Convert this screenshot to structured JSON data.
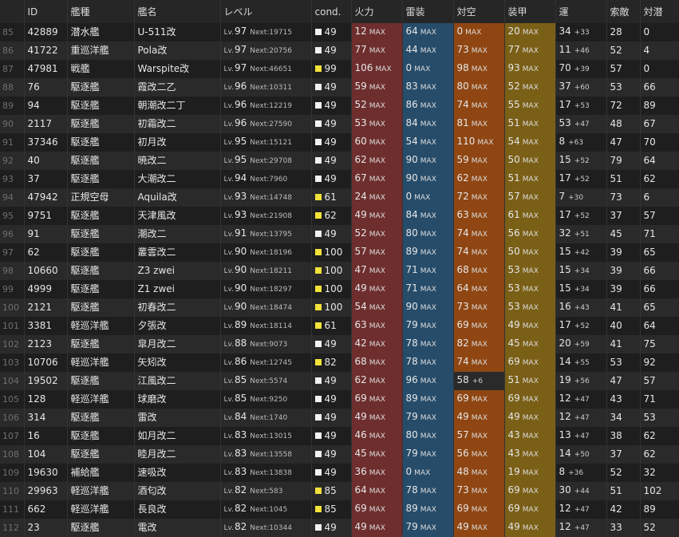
{
  "colors": {
    "cond_white": "#f2f2f2",
    "cond_yellow": "#f2e23a"
  },
  "header": {
    "no": "",
    "id": "ID",
    "type": "艦種",
    "name": "艦名",
    "level": "レベル",
    "cond": "cond.",
    "firepower": "火力",
    "torpedo": "雷装",
    "antiair": "対空",
    "armor": "装甲",
    "luck": "運",
    "los": "索敵",
    "asw": "対潜"
  },
  "labels": {
    "lv": "Lv.",
    "next": "Next:",
    "max": "MAX"
  },
  "rows": [
    {
      "no": "85",
      "id": "42889",
      "type": "潜水艦",
      "name": "U-511改",
      "lv": "97",
      "next": "19715",
      "cond": "49",
      "cond_color": "white",
      "fp": "12",
      "fp_max": true,
      "tp": "64",
      "tp_max": true,
      "aa": "0",
      "aa_max": true,
      "ar": "20",
      "ar_max": true,
      "luck": "34",
      "luck_inc": "+33",
      "los": "28",
      "asw": "0"
    },
    {
      "no": "86",
      "id": "41722",
      "type": "重巡洋艦",
      "name": "Pola改",
      "lv": "97",
      "next": "20756",
      "cond": "49",
      "cond_color": "white",
      "fp": "77",
      "fp_max": true,
      "tp": "44",
      "tp_max": true,
      "aa": "73",
      "aa_max": true,
      "ar": "77",
      "ar_max": true,
      "luck": "11",
      "luck_inc": "+46",
      "los": "52",
      "asw": "4"
    },
    {
      "no": "87",
      "id": "47981",
      "type": "戦艦",
      "name": "Warspite改",
      "lv": "97",
      "next": "46651",
      "cond": "99",
      "cond_color": "yellow",
      "fp": "106",
      "fp_max": true,
      "tp": "0",
      "tp_max": true,
      "aa": "98",
      "aa_max": true,
      "ar": "93",
      "ar_max": true,
      "luck": "70",
      "luck_inc": "+39",
      "los": "57",
      "asw": "0"
    },
    {
      "no": "88",
      "id": "76",
      "type": "駆逐艦",
      "name": "霞改二乙",
      "lv": "96",
      "next": "10311",
      "cond": "49",
      "cond_color": "white",
      "fp": "59",
      "fp_max": true,
      "tp": "83",
      "tp_max": true,
      "aa": "80",
      "aa_max": true,
      "ar": "52",
      "ar_max": true,
      "luck": "37",
      "luck_inc": "+60",
      "los": "53",
      "asw": "66"
    },
    {
      "no": "89",
      "id": "94",
      "type": "駆逐艦",
      "name": "朝潮改二丁",
      "lv": "96",
      "next": "12219",
      "cond": "49",
      "cond_color": "white",
      "fp": "52",
      "fp_max": true,
      "tp": "86",
      "tp_max": true,
      "aa": "74",
      "aa_max": true,
      "ar": "55",
      "ar_max": true,
      "luck": "17",
      "luck_inc": "+53",
      "los": "72",
      "asw": "89"
    },
    {
      "no": "90",
      "id": "2117",
      "type": "駆逐艦",
      "name": "初霜改二",
      "lv": "96",
      "next": "27590",
      "cond": "49",
      "cond_color": "white",
      "fp": "53",
      "fp_max": true,
      "tp": "84",
      "tp_max": true,
      "aa": "81",
      "aa_max": true,
      "ar": "51",
      "ar_max": true,
      "luck": "53",
      "luck_inc": "+47",
      "los": "48",
      "asw": "67"
    },
    {
      "no": "91",
      "id": "37346",
      "type": "駆逐艦",
      "name": "初月改",
      "lv": "95",
      "next": "15121",
      "cond": "49",
      "cond_color": "white",
      "fp": "60",
      "fp_max": true,
      "tp": "54",
      "tp_max": true,
      "aa": "110",
      "aa_max": true,
      "ar": "54",
      "ar_max": true,
      "luck": "8",
      "luck_inc": "+63",
      "los": "47",
      "asw": "70"
    },
    {
      "no": "92",
      "id": "40",
      "type": "駆逐艦",
      "name": "暁改二",
      "lv": "95",
      "next": "29708",
      "cond": "49",
      "cond_color": "white",
      "fp": "62",
      "fp_max": true,
      "tp": "90",
      "tp_max": true,
      "aa": "59",
      "aa_max": true,
      "ar": "50",
      "ar_max": true,
      "luck": "15",
      "luck_inc": "+52",
      "los": "79",
      "asw": "64"
    },
    {
      "no": "93",
      "id": "37",
      "type": "駆逐艦",
      "name": "大潮改二",
      "lv": "94",
      "next": "7960",
      "cond": "49",
      "cond_color": "white",
      "fp": "67",
      "fp_max": true,
      "tp": "90",
      "tp_max": true,
      "aa": "62",
      "aa_max": true,
      "ar": "51",
      "ar_max": true,
      "luck": "17",
      "luck_inc": "+52",
      "los": "51",
      "asw": "62"
    },
    {
      "no": "94",
      "id": "47942",
      "type": "正規空母",
      "name": "Aquila改",
      "lv": "93",
      "next": "14748",
      "cond": "61",
      "cond_color": "yellow",
      "fp": "24",
      "fp_max": true,
      "tp": "0",
      "tp_max": true,
      "aa": "72",
      "aa_max": true,
      "ar": "57",
      "ar_max": true,
      "luck": "7",
      "luck_inc": "+30",
      "los": "73",
      "asw": "6"
    },
    {
      "no": "95",
      "id": "9751",
      "type": "駆逐艦",
      "name": "天津風改",
      "lv": "93",
      "next": "21908",
      "cond": "62",
      "cond_color": "yellow",
      "fp": "49",
      "fp_max": true,
      "tp": "84",
      "tp_max": true,
      "aa": "63",
      "aa_max": true,
      "ar": "61",
      "ar_max": true,
      "luck": "17",
      "luck_inc": "+52",
      "los": "37",
      "asw": "57"
    },
    {
      "no": "96",
      "id": "91",
      "type": "駆逐艦",
      "name": "潮改二",
      "lv": "91",
      "next": "13795",
      "cond": "49",
      "cond_color": "white",
      "fp": "52",
      "fp_max": true,
      "tp": "80",
      "tp_max": true,
      "aa": "74",
      "aa_max": true,
      "ar": "56",
      "ar_max": true,
      "luck": "32",
      "luck_inc": "+51",
      "los": "45",
      "asw": "71"
    },
    {
      "no": "97",
      "id": "62",
      "type": "駆逐艦",
      "name": "叢雲改二",
      "lv": "90",
      "next": "18196",
      "cond": "100",
      "cond_color": "yellow",
      "fp": "57",
      "fp_max": true,
      "tp": "89",
      "tp_max": true,
      "aa": "74",
      "aa_max": true,
      "ar": "50",
      "ar_max": true,
      "luck": "15",
      "luck_inc": "+42",
      "los": "39",
      "asw": "65"
    },
    {
      "no": "98",
      "id": "10660",
      "type": "駆逐艦",
      "name": "Z3 zwei",
      "lv": "90",
      "next": "18211",
      "cond": "100",
      "cond_color": "yellow",
      "fp": "47",
      "fp_max": true,
      "tp": "71",
      "tp_max": true,
      "aa": "68",
      "aa_max": true,
      "ar": "53",
      "ar_max": true,
      "luck": "15",
      "luck_inc": "+34",
      "los": "39",
      "asw": "66"
    },
    {
      "no": "99",
      "id": "4999",
      "type": "駆逐艦",
      "name": "Z1 zwei",
      "lv": "90",
      "next": "18297",
      "cond": "100",
      "cond_color": "yellow",
      "fp": "49",
      "fp_max": true,
      "tp": "71",
      "tp_max": true,
      "aa": "64",
      "aa_max": true,
      "ar": "53",
      "ar_max": true,
      "luck": "15",
      "luck_inc": "+34",
      "los": "39",
      "asw": "66"
    },
    {
      "no": "100",
      "id": "2121",
      "type": "駆逐艦",
      "name": "初春改二",
      "lv": "90",
      "next": "18474",
      "cond": "100",
      "cond_color": "yellow",
      "fp": "54",
      "fp_max": true,
      "tp": "90",
      "tp_max": true,
      "aa": "73",
      "aa_max": true,
      "ar": "53",
      "ar_max": true,
      "luck": "16",
      "luck_inc": "+43",
      "los": "41",
      "asw": "65"
    },
    {
      "no": "101",
      "id": "3381",
      "type": "軽巡洋艦",
      "name": "夕張改",
      "lv": "89",
      "next": "18114",
      "cond": "61",
      "cond_color": "yellow",
      "fp": "63",
      "fp_max": true,
      "tp": "79",
      "tp_max": true,
      "aa": "69",
      "aa_max": true,
      "ar": "49",
      "ar_max": true,
      "luck": "17",
      "luck_inc": "+52",
      "los": "40",
      "asw": "64"
    },
    {
      "no": "102",
      "id": "2123",
      "type": "駆逐艦",
      "name": "皐月改二",
      "lv": "88",
      "next": "9073",
      "cond": "49",
      "cond_color": "white",
      "fp": "42",
      "fp_max": true,
      "tp": "78",
      "tp_max": true,
      "aa": "82",
      "aa_max": true,
      "ar": "45",
      "ar_max": true,
      "luck": "20",
      "luck_inc": "+59",
      "los": "41",
      "asw": "75"
    },
    {
      "no": "103",
      "id": "10706",
      "type": "軽巡洋艦",
      "name": "矢矧改",
      "lv": "86",
      "next": "12745",
      "cond": "82",
      "cond_color": "yellow",
      "fp": "68",
      "fp_max": true,
      "tp": "78",
      "tp_max": true,
      "aa": "74",
      "aa_max": true,
      "ar": "69",
      "ar_max": true,
      "luck": "14",
      "luck_inc": "+55",
      "los": "53",
      "asw": "92"
    },
    {
      "no": "104",
      "id": "19502",
      "type": "駆逐艦",
      "name": "江風改二",
      "lv": "85",
      "next": "5574",
      "cond": "49",
      "cond_color": "white",
      "fp": "62",
      "fp_max": true,
      "tp": "96",
      "tp_max": true,
      "aa": "58",
      "aa_max": false,
      "aa_inc": "+6",
      "ar": "51",
      "ar_max": true,
      "luck": "19",
      "luck_inc": "+56",
      "los": "47",
      "asw": "57"
    },
    {
      "no": "105",
      "id": "128",
      "type": "軽巡洋艦",
      "name": "球磨改",
      "lv": "85",
      "next": "9250",
      "cond": "49",
      "cond_color": "white",
      "fp": "69",
      "fp_max": true,
      "tp": "89",
      "tp_max": true,
      "aa": "69",
      "aa_max": true,
      "ar": "69",
      "ar_max": true,
      "luck": "12",
      "luck_inc": "+47",
      "los": "43",
      "asw": "71"
    },
    {
      "no": "106",
      "id": "314",
      "type": "駆逐艦",
      "name": "雷改",
      "lv": "84",
      "next": "1740",
      "cond": "49",
      "cond_color": "white",
      "fp": "49",
      "fp_max": true,
      "tp": "79",
      "tp_max": true,
      "aa": "49",
      "aa_max": true,
      "ar": "49",
      "ar_max": true,
      "luck": "12",
      "luck_inc": "+47",
      "los": "34",
      "asw": "53"
    },
    {
      "no": "107",
      "id": "16",
      "type": "駆逐艦",
      "name": "如月改二",
      "lv": "83",
      "next": "13015",
      "cond": "49",
      "cond_color": "white",
      "fp": "46",
      "fp_max": true,
      "tp": "80",
      "tp_max": true,
      "aa": "57",
      "aa_max": true,
      "ar": "43",
      "ar_max": true,
      "luck": "13",
      "luck_inc": "+47",
      "los": "38",
      "asw": "62"
    },
    {
      "no": "108",
      "id": "104",
      "type": "駆逐艦",
      "name": "睦月改二",
      "lv": "83",
      "next": "13558",
      "cond": "49",
      "cond_color": "white",
      "fp": "45",
      "fp_max": true,
      "tp": "79",
      "tp_max": true,
      "aa": "56",
      "aa_max": true,
      "ar": "43",
      "ar_max": true,
      "luck": "14",
      "luck_inc": "+50",
      "los": "37",
      "asw": "62"
    },
    {
      "no": "109",
      "id": "19630",
      "type": "補給艦",
      "name": "速吸改",
      "lv": "83",
      "next": "13838",
      "cond": "49",
      "cond_color": "white",
      "fp": "36",
      "fp_max": true,
      "tp": "0",
      "tp_max": true,
      "aa": "48",
      "aa_max": true,
      "ar": "19",
      "ar_max": true,
      "luck": "8",
      "luck_inc": "+36",
      "los": "52",
      "asw": "32"
    },
    {
      "no": "110",
      "id": "29963",
      "type": "軽巡洋艦",
      "name": "酒匂改",
      "lv": "82",
      "next": "583",
      "cond": "85",
      "cond_color": "yellow",
      "fp": "64",
      "fp_max": true,
      "tp": "78",
      "tp_max": true,
      "aa": "73",
      "aa_max": true,
      "ar": "69",
      "ar_max": true,
      "luck": "30",
      "luck_inc": "+44",
      "los": "51",
      "asw": "102"
    },
    {
      "no": "111",
      "id": "662",
      "type": "軽巡洋艦",
      "name": "長良改",
      "lv": "82",
      "next": "1045",
      "cond": "85",
      "cond_color": "yellow",
      "fp": "69",
      "fp_max": true,
      "tp": "89",
      "tp_max": true,
      "aa": "69",
      "aa_max": true,
      "ar": "69",
      "ar_max": true,
      "luck": "12",
      "luck_inc": "+47",
      "los": "42",
      "asw": "89"
    },
    {
      "no": "112",
      "id": "23",
      "type": "駆逐艦",
      "name": "電改",
      "lv": "82",
      "next": "10344",
      "cond": "49",
      "cond_color": "white",
      "fp": "49",
      "fp_max": true,
      "tp": "79",
      "tp_max": true,
      "aa": "49",
      "aa_max": true,
      "ar": "49",
      "ar_max": true,
      "luck": "12",
      "luck_inc": "+47",
      "los": "33",
      "asw": "52"
    }
  ]
}
